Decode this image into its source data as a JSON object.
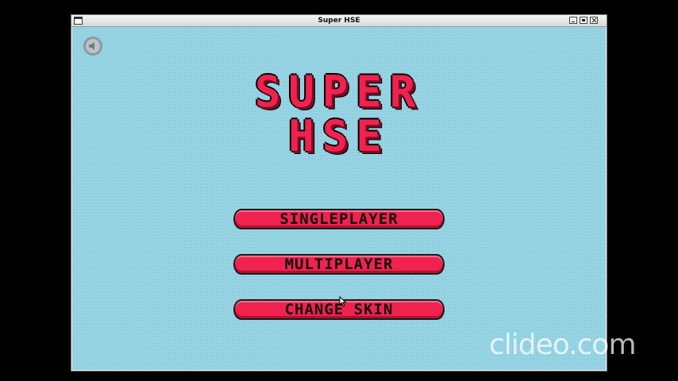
{
  "window": {
    "title": "Super HSE"
  },
  "game": {
    "title_line1": "SUPER",
    "title_line2": "HSE",
    "menu": {
      "singleplayer": "SINGLEPLAYER",
      "multiplayer": "MULTIPLAYER",
      "change_skin": "CHANGE SKIN"
    },
    "sound_icon": "speaker-mute-icon"
  },
  "watermark": "clideo.com",
  "colors": {
    "background": "#96d4e3",
    "accent": "#f0224f",
    "window_bg": "#000000"
  }
}
